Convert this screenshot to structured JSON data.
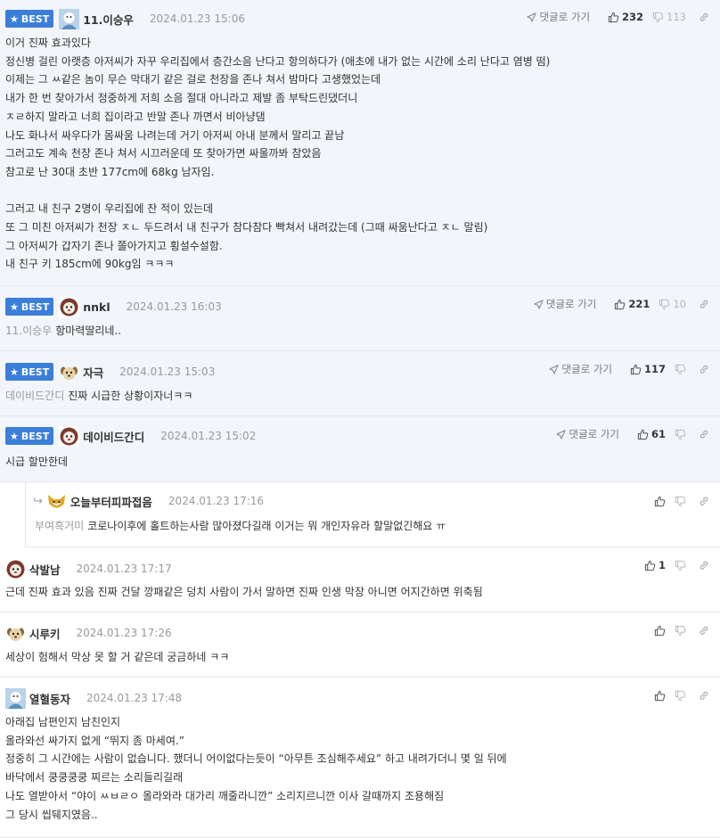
{
  "labels": {
    "best": "BEST",
    "go_to_reply": "댓글로 가기"
  },
  "icons": {
    "best_badge": "star-icon",
    "go_to_reply": "send-arrow-icon",
    "upvote": "thumbs-up-icon",
    "downvote": "thumbs-down-icon",
    "link": "link-icon",
    "reply_marker": "reply-arrow-icon"
  },
  "colors": {
    "best_badge": "#3b7fd9",
    "best_background": "#f2f5fa",
    "muted_text": "#9a9a9a"
  },
  "comments": [
    {
      "nick": "11.이승우",
      "date": "2024.01.23 15:06",
      "up": "232",
      "down": "113",
      "lines": [
        "이거 진짜 효과있다",
        "정신병 걸린 아랫층 아저씨가 자꾸 우리집에서 층간소음 난다고 항의하다가 (애초에 내가 없는 시간에 소리 난다고 염병 떰)",
        "이제는 그 ㅆ같은 놈이 무슨 막대기 같은 걸로 천장을 존나 쳐서 밤마다 고생했었는데",
        "내가 한 번 찾아가서 정중하게 저희 소음 절대 아니라고 제발 좀 부탁드린댔더니",
        "ㅈㄹ하지 말라고 너희 집이라고 반말 존나 까면서 비아냥댐",
        "나도 화나서 싸우다가 몸싸움 나려는데 거기 아저씨 아내 분께서 말리고 끝남",
        "그러고도 계속 천장 존나 쳐서 시끄러운데 또 찾아가면 싸울까봐 참았음",
        "참고로 난 30대 초반 177cm에 68kg 남자임.",
        "",
        "그러고 내 친구 2명이 우리집에 잔 적이 있는데",
        "또 그 미친 아저씨가 천장 ㅈㄴ 두드려서 내 친구가 참다참다 빡쳐서 내려갔는데 (그때 싸움난다고 ㅈㄴ 말림)",
        "그 아저씨가 갑자기 존나 쫄아가지고 횡설수설함.",
        "내 친구 키 185cm에 90kg임 ㅋㅋㅋ"
      ]
    },
    {
      "nick": "nnkl",
      "date": "2024.01.23 16:03",
      "up": "221",
      "down": "10",
      "mention": "11.이승우",
      "lines": [
        "항마력딸리네.."
      ]
    },
    {
      "nick": "자극",
      "date": "2024.01.23 15:03",
      "up": "117",
      "mention": "데이비드간디",
      "lines": [
        "진짜 시급한 상황이자너ㅋㅋ"
      ]
    },
    {
      "nick": "데이비드간디",
      "date": "2024.01.23 15:02",
      "up": "61",
      "lines": [
        "시급 할만한데"
      ]
    },
    {
      "nick": "오늘부터피파접음",
      "date": "2024.01.23 17:16",
      "mention": "부여흑거미",
      "lines": [
        "코로나이후에 홀트하는사람 많아졌다길래 이거는 뭐 개인자유라 할말없긴해요 ㅠ"
      ]
    },
    {
      "nick": "삭발남",
      "date": "2024.01.23 17:17",
      "up": "1",
      "lines": [
        "근데 진짜 효과 있음 진짜 건달 깡패같은 덩치 사람이 가서 말하면 진짜 인생 막장 아니면 어지간하면 위축됨"
      ]
    },
    {
      "nick": "시루키",
      "date": "2024.01.23 17:26",
      "lines": [
        "세상이 험해서 막상 못 할 거 같은데 궁금하네 ㅋㅋ"
      ]
    },
    {
      "nick": "열혈동자",
      "date": "2024.01.23 17:48",
      "lines": [
        "아래집 남편인지 남친인지",
        "올라와선 싸가지 없게 “뛰지 좀 마세여.”",
        "정중히 그 시간에는 사람이 없습니다. 했더니 어이없다는듯이 “아무튼 조심해주세요” 하고 내려가더니 몇 일 뒤에",
        "바닥에서 쿵쿵쿵쿵 찌르는 소리들리길래",
        "나도 열받아서 “야이 ㅆㅂㄹㅇ 올라와라 대가리 깨줄라니깐” 소리지르니깐 이사 갈때까지 조용해짐",
        "그 당시 씹뒈지였음.."
      ]
    }
  ]
}
